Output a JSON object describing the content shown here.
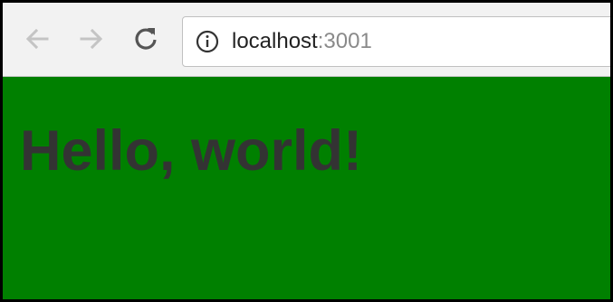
{
  "browser": {
    "address_bar": {
      "host": "localhost",
      "port": ":3001"
    },
    "icons": {
      "back": "back-arrow-icon",
      "forward": "forward-arrow-icon",
      "reload": "reload-icon",
      "info": "info-icon"
    }
  },
  "page": {
    "heading": "Hello, world!",
    "background_color": "#008000",
    "heading_color": "#333333"
  }
}
